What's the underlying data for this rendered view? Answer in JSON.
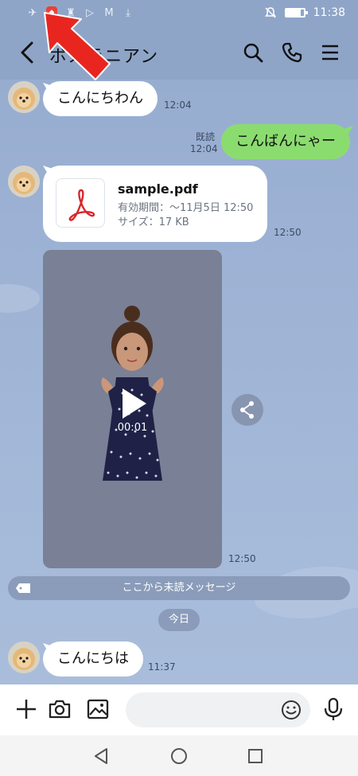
{
  "status_bar": {
    "time": "11:38",
    "icons_left": [
      "airplane-icon",
      "huawei-icon",
      "key-icon",
      "play-store-icon",
      "gmail-icon",
      "download-icon"
    ],
    "icons_right": [
      "mute-icon",
      "battery-icon"
    ],
    "battery_level_percent": 85
  },
  "header": {
    "title": "ポメラニアン",
    "icons": [
      "back-icon",
      "search-icon",
      "phone-icon",
      "menu-icon"
    ]
  },
  "messages": [
    {
      "sender": "them",
      "type": "text",
      "text": "こんにちわん",
      "time": "12:04"
    },
    {
      "sender": "me",
      "type": "text",
      "text": "こんばんにゃー",
      "time": "12:04",
      "read_label": "既読"
    },
    {
      "sender": "them",
      "type": "file",
      "file_name": "sample.pdf",
      "expiry": "有効期間：〜11月5日 12:50",
      "size": "サイズ：17 KB",
      "time": "12:50"
    },
    {
      "sender": "them",
      "type": "video",
      "duration": "00:01",
      "time": "12:50"
    },
    {
      "sender": "them",
      "type": "text",
      "text": "こんにちは",
      "time": "11:37"
    }
  ],
  "unread_divider": "ここから未読メッセージ",
  "date_divider": "今日",
  "input_bar": {
    "placeholder": "",
    "icons": [
      "plus-icon",
      "camera-icon",
      "image-icon",
      "emoji-icon",
      "mic-icon"
    ]
  },
  "colors": {
    "chat_background": "#97add0",
    "my_bubble": "#8bdc6f",
    "their_bubble": "#ffffff",
    "annotation_arrow": "#e8261f"
  }
}
